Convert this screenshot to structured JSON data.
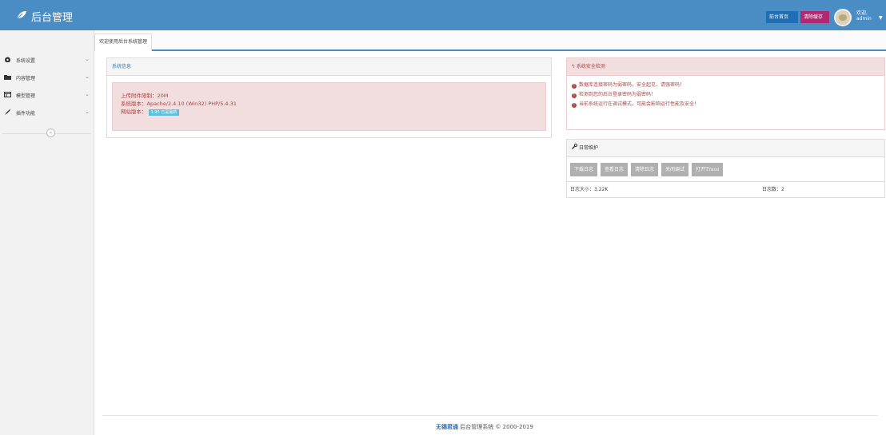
{
  "header": {
    "brand": "后台管理",
    "btn_front": "前台首页",
    "btn_cache": "清除缓存",
    "welcome_line1": "欢迎,",
    "welcome_line2": "admin",
    "colors": {
      "header_bg": "#4a8cc4",
      "front_btn": "#1e6fb6",
      "cache_btn": "#b0286f"
    }
  },
  "sidebar": {
    "items": [
      {
        "label": "系统设置",
        "icon": "dashboard-icon"
      },
      {
        "label": "内容管理",
        "icon": "folder-icon"
      },
      {
        "label": "模型管理",
        "icon": "table-icon"
      },
      {
        "label": "插件功能",
        "icon": "rocket-icon"
      }
    ],
    "collapse": "«"
  },
  "tabs": {
    "active": "欢迎使用后台系统管理"
  },
  "sys_info": {
    "title": "系统信息",
    "upload_limit": "上传附件限制：20M",
    "sys_version": "系统版本：Apache/2.4.10 (Win32) PHP/5.4.31",
    "site_version_label": "网站版本：",
    "site_version_badge": "1.95 已是最新"
  },
  "security": {
    "title": "系统安全检测",
    "items": [
      "数据库连接密码为弱密码，安全起见，请强密码！",
      "检测到您的后台登录密码为弱密码！",
      "当前系统运行在调试模式，可能会影响运行性能及安全！"
    ]
  },
  "maintenance": {
    "title": "日常维护",
    "buttons": [
      "下载日志",
      "查看日志",
      "清除日志",
      "关闭调试",
      "打开Trace"
    ],
    "log_size": "日志大小：3.22K",
    "log_count": "日志数：2"
  },
  "footer": {
    "brand": "无锡君通",
    "text": " 后台管理系统 © 2000-2019"
  }
}
